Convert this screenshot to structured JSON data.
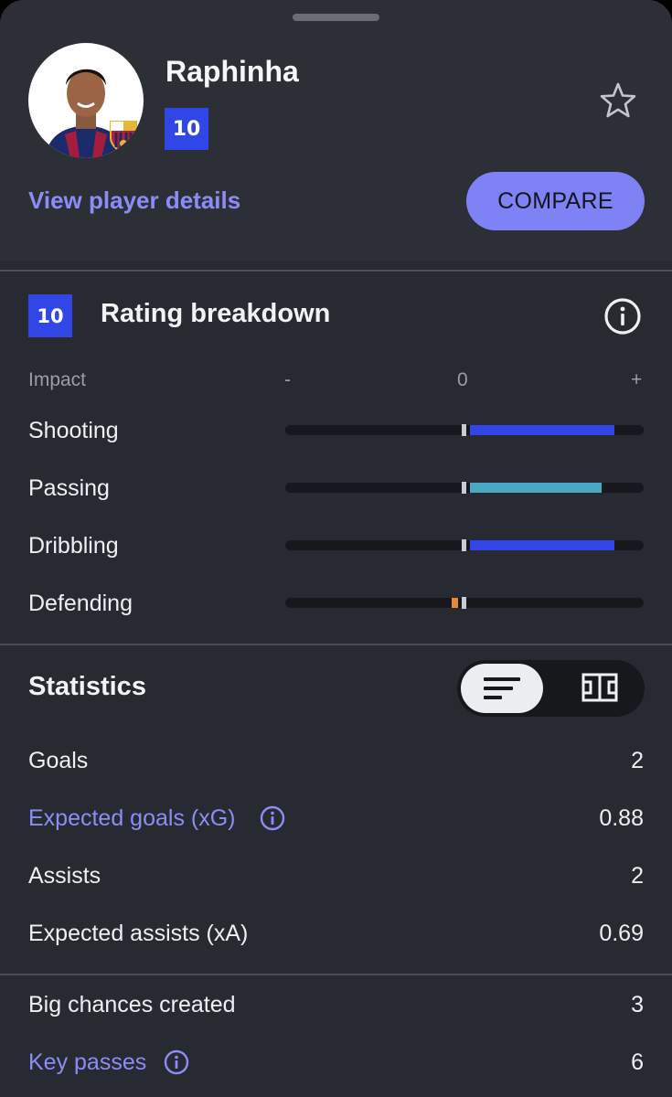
{
  "player": {
    "name": "Raphinha",
    "rating": "10",
    "details_link": "View player details",
    "compare_label": "COMPARE"
  },
  "rating_breakdown": {
    "badge": "10",
    "title": "Rating breakdown",
    "impact_label": "Impact",
    "scale_minus": "-",
    "scale_zero": "0",
    "scale_plus": "+",
    "rows": [
      {
        "label": "Shooting",
        "impact": 0.84,
        "color": "#3146e6"
      },
      {
        "label": "Passing",
        "impact": 0.77,
        "color": "#4aa8c4"
      },
      {
        "label": "Dribbling",
        "impact": 0.84,
        "color": "#3146e6"
      },
      {
        "label": "Defending",
        "impact": -0.07,
        "color": "#e8893a"
      }
    ]
  },
  "statistics": {
    "title": "Statistics",
    "view_options": [
      "list-view-icon",
      "pitch-view-icon"
    ],
    "selected_view": "list-view-icon",
    "rows": [
      {
        "label": "Goals",
        "value": "2",
        "link": false
      },
      {
        "label": "Expected goals (xG)",
        "value": "0.88",
        "link": true
      },
      {
        "label": "Assists",
        "value": "2",
        "link": false
      },
      {
        "label": "Expected assists (xA)",
        "value": "0.69",
        "link": false
      },
      {
        "label": "Big chances created",
        "value": "3",
        "link": false
      },
      {
        "label": "Key passes",
        "value": "6",
        "link": true
      }
    ]
  },
  "colors": {
    "accent": "#7f82f5",
    "rating_badge": "#3146e6",
    "background": "#272a31"
  }
}
